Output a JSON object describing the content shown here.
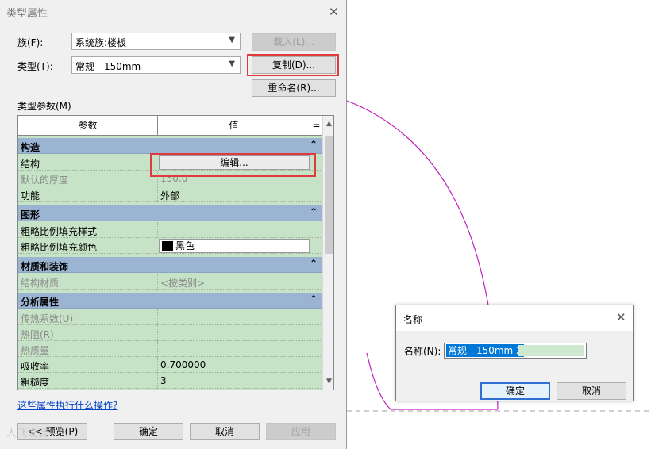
{
  "type_dialog": {
    "title": "类型属性",
    "family_label": "族(F):",
    "family_value": "系统族:楼板",
    "type_label": "类型(T):",
    "type_value": "常规 - 150mm",
    "load_button": "载入(L)...",
    "duplicate_button": "复制(D)...",
    "rename_button": "重命名(R)...",
    "type_params_label": "类型参数(M)",
    "grid": {
      "col_param": "参数",
      "col_value": "值",
      "col_sort": "=",
      "groups": [
        {
          "name": "构造",
          "rows": [
            {
              "param": "结构",
              "value": "编辑...",
              "kind": "button"
            },
            {
              "param": "默认的厚度",
              "value": "150.0",
              "dim": true
            },
            {
              "param": "功能",
              "value": "外部"
            }
          ]
        },
        {
          "name": "图形",
          "rows": [
            {
              "param": "粗略比例填充样式",
              "value": ""
            },
            {
              "param": "粗略比例填充颜色",
              "value": "黑色",
              "kind": "color",
              "color": "#000000"
            }
          ]
        },
        {
          "name": "材质和装饰",
          "rows": [
            {
              "param": "结构材质",
              "value": "<按类别>",
              "dim": true
            }
          ]
        },
        {
          "name": "分析属性",
          "rows": [
            {
              "param": "传热系数(U)",
              "value": "",
              "dim": true
            },
            {
              "param": "热阻(R)",
              "value": "",
              "dim": true
            },
            {
              "param": "热质量",
              "value": "",
              "dim": true
            },
            {
              "param": "吸收率",
              "value": "0.700000"
            },
            {
              "param": "粗糙度",
              "value": "3"
            }
          ]
        }
      ]
    },
    "help_link": "这些属性执行什么操作?",
    "preview_button": "<< 预览(P)",
    "ok_button": "确定",
    "cancel_button": "取消",
    "apply_button": "应用"
  },
  "name_dialog": {
    "title": "名称",
    "name_label": "名称(N):",
    "name_value": "常规 - 150mm 2",
    "ok_button": "确定",
    "cancel_button": "取消"
  },
  "watermark_text": "人飞说谈",
  "colors": {
    "grid_row_bg": "#c7e3c7",
    "group_header_bg": "#9ab4d2",
    "highlight": "#e0393e",
    "drawing_line": "#c020c0",
    "selection": "#0078d7"
  }
}
